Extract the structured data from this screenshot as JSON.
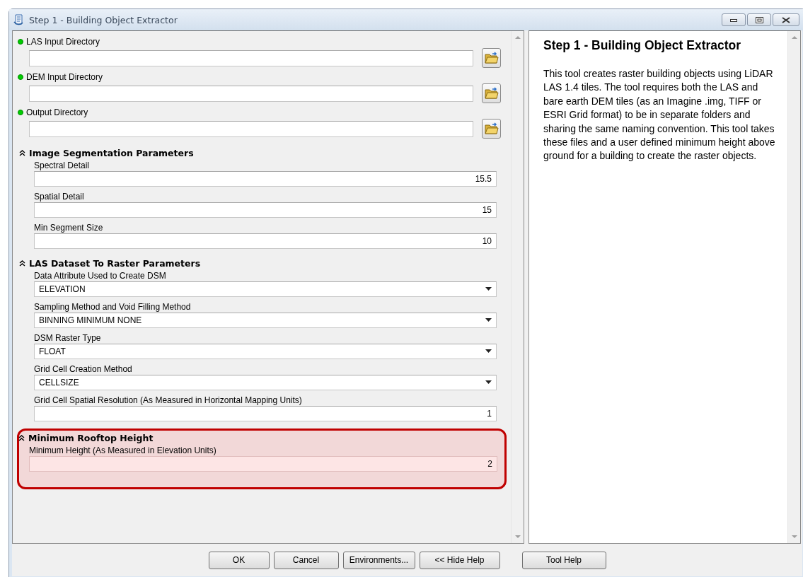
{
  "window": {
    "title": "Step 1 - Building Object Extractor"
  },
  "inputs": [
    {
      "label": "LAS Input Directory",
      "required": true
    },
    {
      "label": "DEM Input Directory",
      "required": true
    },
    {
      "label": "Output Directory",
      "required": true
    }
  ],
  "sections": [
    {
      "title": "Image Segmentation Parameters",
      "expanded": true,
      "highlighted": false,
      "params": [
        {
          "label": "Spectral Detail",
          "kind": "number",
          "value": "15.5"
        },
        {
          "label": "Spatial Detail",
          "kind": "number",
          "value": "15"
        },
        {
          "label": "Min Segment Size",
          "kind": "number",
          "value": "10"
        }
      ]
    },
    {
      "title": "LAS Dataset To Raster Parameters",
      "expanded": true,
      "highlighted": false,
      "params": [
        {
          "label": "Data Attribute Used to Create DSM",
          "kind": "dropdown",
          "value": "ELEVATION"
        },
        {
          "label": "Sampling Method and Void Filling Method",
          "kind": "dropdown",
          "value": "BINNING MINIMUM NONE"
        },
        {
          "label": "DSM Raster Type",
          "kind": "dropdown",
          "value": "FLOAT"
        },
        {
          "label": "Grid Cell Creation Method",
          "kind": "dropdown",
          "value": "CELLSIZE"
        },
        {
          "label": "Grid Cell Spatial Resolution (As Measured in Horizontal Mapping Units)",
          "kind": "number",
          "value": "1"
        }
      ]
    },
    {
      "title": "Minimum Rooftop Height",
      "expanded": true,
      "highlighted": true,
      "params": [
        {
          "label": "Minimum Height (As Measured in Elevation Units)",
          "kind": "number",
          "value": "2"
        }
      ]
    }
  ],
  "help": {
    "title": "Step 1 - Building Object Extractor",
    "text": "This tool creates raster building objects using LiDAR LAS 1.4 tiles. The tool requires both the LAS and bare earth DEM tiles (as an Imagine .img, TIFF or ESRI Grid format) to be in separate folders and sharing the same naming convention. This tool takes these files and a user defined minimum height above ground for a building to create the raster objects."
  },
  "buttons": [
    "OK",
    "Cancel",
    "Environments...",
    "<< Hide Help",
    "Tool Help"
  ]
}
